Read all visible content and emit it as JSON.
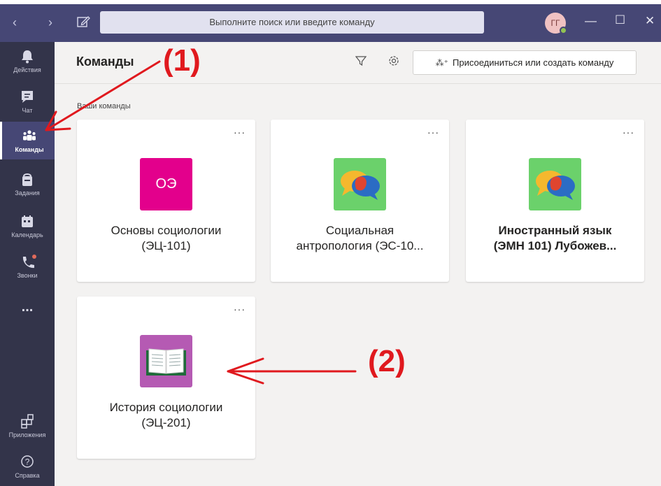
{
  "titlebar": {
    "search_placeholder": "Выполните поиск или введите команду",
    "avatar_initials": "ГГ",
    "status_color": "#92c353"
  },
  "rail": {
    "items": [
      {
        "label": "Действия",
        "icon": "bell-icon"
      },
      {
        "label": "Чат",
        "icon": "chat-icon"
      },
      {
        "label": "Команды",
        "icon": "teams-icon",
        "active": true
      },
      {
        "label": "Задания",
        "icon": "assignments-icon"
      },
      {
        "label": "Календарь",
        "icon": "calendar-icon"
      },
      {
        "label": "Звонки",
        "icon": "phone-icon"
      },
      {
        "label": "...",
        "icon": "more-icon"
      },
      {
        "label": "Приложения",
        "icon": "apps-icon"
      },
      {
        "label": "Справка",
        "icon": "help-icon"
      }
    ]
  },
  "header": {
    "title": "Команды",
    "join_label": "Присоединиться или создать команду"
  },
  "section_label": "Ваши команды",
  "teams": [
    {
      "name": "Основы социологии\n(ЭЦ-101)",
      "logo": "ОЭ",
      "logo_color": "#e3008c"
    },
    {
      "name": "Социальная\nантропология (ЭС-10...",
      "logo": "speech-bubbles-icon",
      "logo_color": "#6bd16b"
    },
    {
      "name": "Иностранный язык\n(ЭМН 101) Лубожев...",
      "logo": "speech-bubbles-icon",
      "logo_color": "#6bd16b",
      "bold": true
    },
    {
      "name": "История социологии\n(ЭЦ-201)",
      "logo": "open-book-icon",
      "logo_color": "#b55ab3"
    }
  ],
  "annotations": {
    "label1": "(1)",
    "label2": "(2)",
    "color": "#e0191e"
  }
}
